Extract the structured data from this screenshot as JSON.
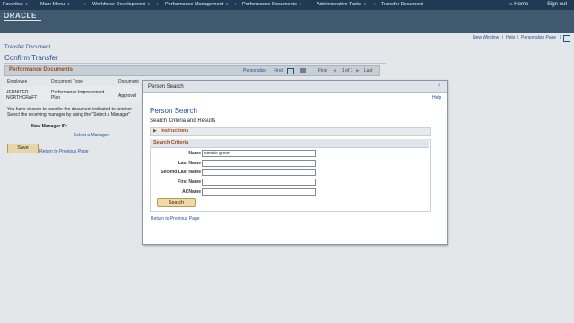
{
  "nav": {
    "favorites": "Favorites",
    "main_menu": "Main Menu",
    "workforce": "Workforce Development",
    "performance_mgmt": "Performance Management",
    "performance_docs": "Performance Documents",
    "admin_tasks": "Administrative Tasks",
    "transfer_doc": "Transfer Document",
    "home": "Home",
    "sign_out": "Sign out"
  },
  "banner": {
    "logo": "ORACLE"
  },
  "utility": {
    "new_window": "New Window",
    "help": "Help",
    "personalize": "Personalize Page"
  },
  "page": {
    "breadcrumb": "Transfer Document",
    "title": "Confirm Transfer"
  },
  "grid": {
    "title": "Performance Documents",
    "personalize": "Personalize",
    "find": "Find",
    "first": "First",
    "range": "1 of 1",
    "last": "Last",
    "columns": [
      "Employee",
      "Document Type",
      "Document"
    ],
    "row": {
      "name_line1": "JENNIFER",
      "name_line2": "NORTHCRAFT",
      "type_line1": "Performance Improvement",
      "type_line2": "Plan",
      "doc": "Approval"
    }
  },
  "message": {
    "line1": "You have chosen to transfer the document indicated to another",
    "line2": "Select the receiving manager by using the \"Select a Manager\""
  },
  "manager": {
    "label": "New Manager ID:",
    "select_link": "Select a Manager"
  },
  "actions": {
    "save": "Save",
    "return": "Return to Previous Page"
  },
  "modal": {
    "title": "Person Search",
    "close": "×",
    "help": "Help",
    "heading": "Person Search",
    "subheading": "Search Criteria and Results",
    "instructions": "Instructions",
    "criteria": "Search Criteria",
    "fields": [
      {
        "label": "Name",
        "value": "connie green"
      },
      {
        "label": "Last Name",
        "value": ""
      },
      {
        "label": "Second Last Name",
        "value": ""
      },
      {
        "label": "First Name",
        "value": ""
      },
      {
        "label": "ACName",
        "value": ""
      }
    ],
    "search_button": "Search",
    "return": "Return to Previous Page"
  }
}
